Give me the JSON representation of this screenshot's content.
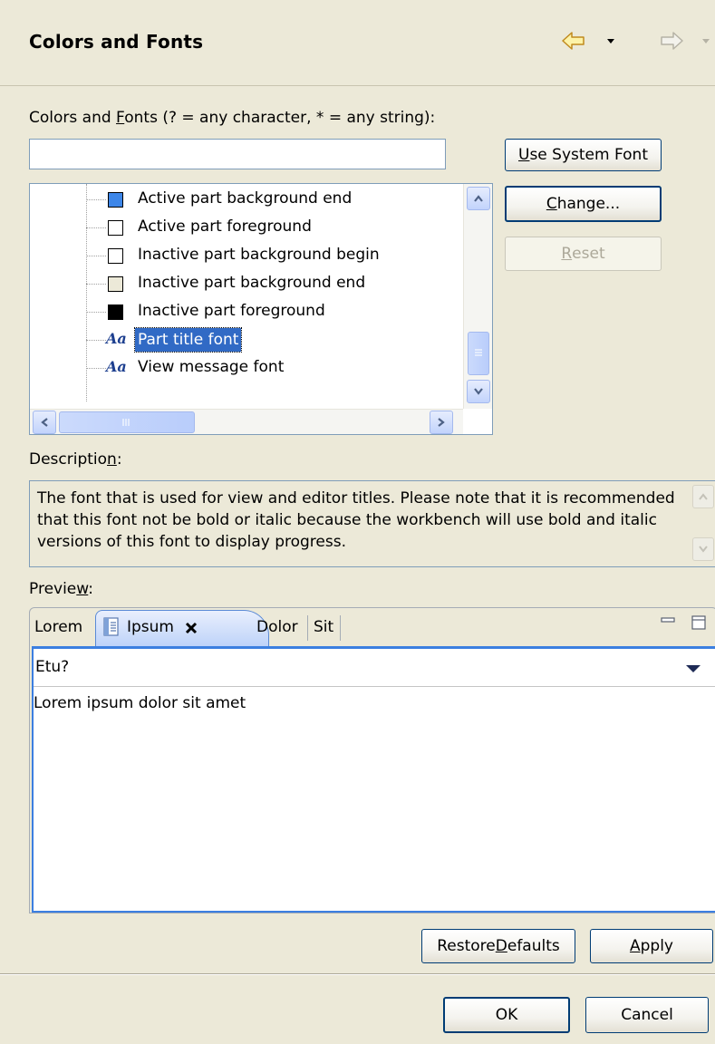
{
  "header": {
    "title": "Colors and Fonts",
    "back_icon": "back-arrow-icon",
    "forward_icon": "forward-arrow-icon"
  },
  "filter": {
    "label_pre": "Colors and ",
    "label_accel": "F",
    "label_post": "onts (? = any character, * = any string):",
    "value": ""
  },
  "buttons": {
    "use_system_font_accel": "U",
    "use_system_font_rest": "se System Font",
    "change_accel": "C",
    "change_rest": "hange...",
    "reset_accel": "R",
    "reset_rest": "eset"
  },
  "tree": {
    "items": [
      {
        "label": "Active part background end",
        "kind": "color",
        "color": "#3d86e8"
      },
      {
        "label": "Active part foreground",
        "kind": "color",
        "color": "#ffffff"
      },
      {
        "label": "Inactive part background begin",
        "kind": "color",
        "color": "#ffffff"
      },
      {
        "label": "Inactive part background end",
        "kind": "color",
        "color": "#ece9d8"
      },
      {
        "label": "Inactive part foreground",
        "kind": "color",
        "color": "#000000"
      },
      {
        "label": "Part title font",
        "kind": "font",
        "icon_text": "Aa",
        "selected": true
      },
      {
        "label": "View message font",
        "kind": "font",
        "icon_text": "Aa"
      }
    ]
  },
  "description": {
    "label_pre": "Descriptio",
    "label_accel": "n",
    "label_post": ":",
    "text": "The font that is used for view and editor titles.  Please note that it is recommended that this font not be bold or italic because the workbench will use bold and italic versions of this font to display progress."
  },
  "preview": {
    "label_pre": "Previe",
    "label_accel": "w",
    "label_post": ":",
    "tabs": [
      "Lorem",
      "Ipsum",
      "Dolor",
      "Sit"
    ],
    "active_tab": "Ipsum",
    "toolbar_text": "Etu?",
    "body_text": "Lorem ipsum dolor sit amet"
  },
  "footer": {
    "restore_pre": "Restore ",
    "restore_accel": "D",
    "restore_post": "efaults",
    "apply_accel": "A",
    "apply_rest": "pply",
    "ok_label": "OK",
    "cancel_label": "Cancel"
  },
  "colors": {
    "selection": "#316ac5",
    "accent": "#3c7fe0",
    "dialog_bg": "#ece9d8"
  }
}
